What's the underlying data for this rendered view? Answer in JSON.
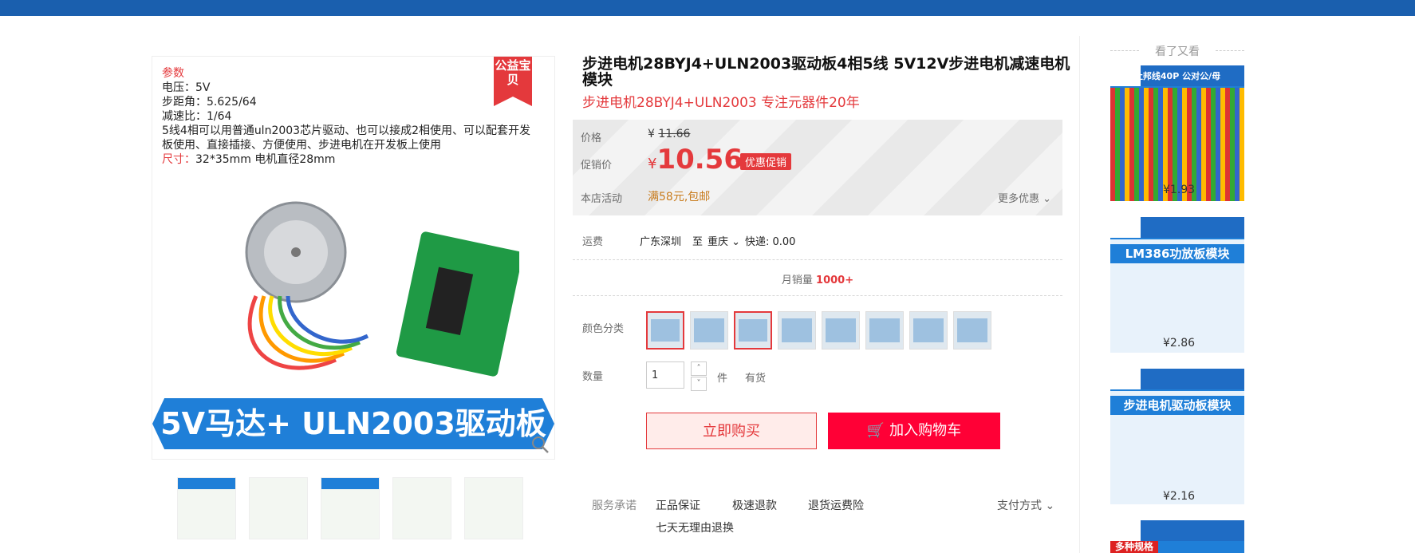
{
  "gallery": {
    "spec": {
      "heading": "参数",
      "voltage": "电压：5V",
      "step_angle": "步距角：5.625/64",
      "reduction": "减速比：1/64",
      "desc": "5线4相可以用普通uln2003芯片驱动、也可以接成2相使用、可以配套开发板使用、直接插接、方便使用、步进电机在开发板上使用",
      "size_label": "尺寸：",
      "size_value": "32*35mm  电机直径28mm"
    },
    "badge": "公益宝贝",
    "banner": "5V马达+ ULN2003驱动板"
  },
  "product": {
    "title": "步进电机28BYJ4+ULN2003驱动板4相5线 5V12V步进电机减速电机模块",
    "subtitle": "步进电机28BYJ4+ULN2003 专注元器件20年",
    "price_label": "价格",
    "original_currency": "¥",
    "original_price": "11.66",
    "promo_label": "促销价",
    "promo_currency": "¥",
    "promo_price": "10.56",
    "promo_tag": "优惠促销",
    "shop_activity_label": "本店活动",
    "shop_activity": "满58元,包邮",
    "more_offers": "更多优惠",
    "shipping_label": "运费",
    "ship_from": "广东深圳",
    "ship_to_word": "至",
    "ship_to": "重庆",
    "express": "快递: 0.00",
    "monthly_label": "月销量",
    "monthly_value": "1000+",
    "color_label": "颜色分类",
    "quantity_label": "数量",
    "quantity_value": "1",
    "unit": "件",
    "stock": "有货",
    "buy_now": "立即购买",
    "add_cart": "加入购物车"
  },
  "service": {
    "label": "服务承诺",
    "items": [
      "正品保证",
      "极速退款",
      "退货运费险",
      "七天无理由退换"
    ],
    "payment": "支付方式"
  },
  "sidebar": {
    "title": "看了又看",
    "items": [
      {
        "price": "¥1.93",
        "caption": "杜邦线40P 公对公/母"
      },
      {
        "price": "¥2.86",
        "caption": "LM386功放板模块"
      },
      {
        "price": "¥2.16",
        "caption": "步进电机驱动板模块"
      },
      {
        "price": "",
        "caption": "多种规格"
      }
    ]
  },
  "colors": {
    "accent": "#e4393c",
    "cart": "#ff0036",
    "topbar": "#1a5fae"
  }
}
